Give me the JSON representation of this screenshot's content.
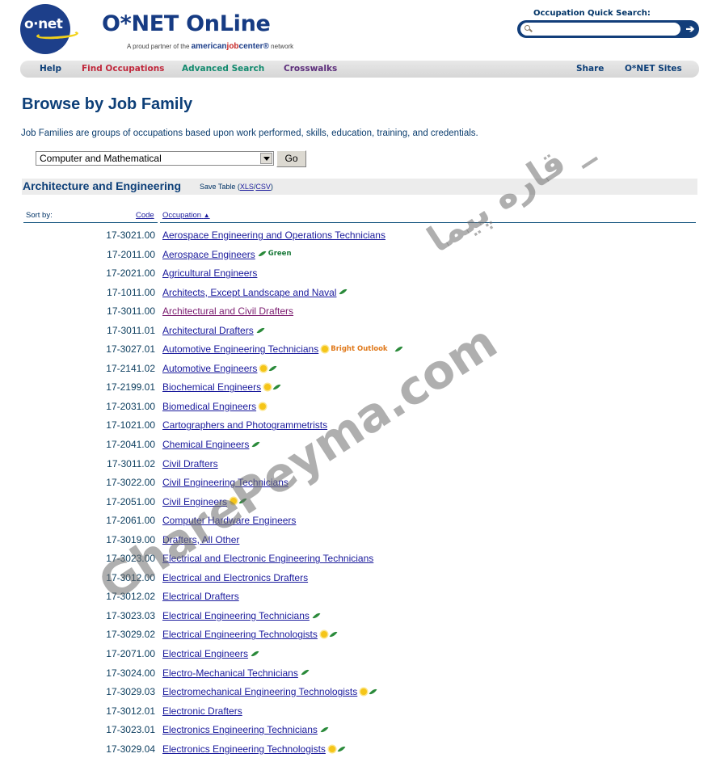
{
  "header": {
    "logo_text": "o·net",
    "site_title": "O*NET OnLine",
    "tagline_prefix": "A proud partner of the",
    "tagline_brand_a": "american",
    "tagline_brand_b": "job",
    "tagline_brand_c": "center®",
    "tagline_suffix": "network",
    "quick_search": {
      "label": "Occupation Quick Search:",
      "value": "",
      "placeholder": "",
      "go_icon": "arrow-right-icon"
    }
  },
  "nav": {
    "left": [
      {
        "label": "Help",
        "color": "#0d3f78"
      },
      {
        "label": "Find Occupations",
        "color": "#c0283c"
      },
      {
        "label": "Advanced Search",
        "color": "#128a6e"
      },
      {
        "label": "Crosswalks",
        "color": "#5b2c7a"
      }
    ],
    "right": [
      {
        "label": "Share",
        "color": "#0d3f78"
      },
      {
        "label": "O*NET Sites",
        "color": "#0d3f78"
      }
    ]
  },
  "main": {
    "title": "Browse by Job Family",
    "intro": "Job Families are groups of occupations based upon work performed, skills, education, training, and credentials.",
    "family_select": {
      "selected": "Computer and Mathematical"
    },
    "go_label": "Go",
    "section": {
      "title": "Architecture and Engineering",
      "save_table_prefix": "Save Table (",
      "xls": "XLS",
      "sep": "/",
      "csv": "CSV",
      "save_table_suffix": ")"
    },
    "sort": {
      "label": "Sort by:",
      "code": "Code",
      "occupation": "Occupation",
      "direction_icon": "▲"
    },
    "badge_labels": {
      "green": "Green",
      "bright": "Bright Outlook"
    },
    "occupations": [
      {
        "code": "17-3021.00",
        "name": "Aerospace Engineering and Operations Technicians",
        "bright": false,
        "green": false
      },
      {
        "code": "17-2011.00",
        "name": "Aerospace Engineers",
        "bright": false,
        "green": true,
        "green_label": true
      },
      {
        "code": "17-2021.00",
        "name": "Agricultural Engineers",
        "bright": false,
        "green": false
      },
      {
        "code": "17-1011.00",
        "name": "Architects, Except Landscape and Naval",
        "bright": false,
        "green": true
      },
      {
        "code": "17-3011.00",
        "name": "Architectural and Civil Drafters",
        "bright": false,
        "green": false,
        "visited": true
      },
      {
        "code": "17-3011.01",
        "name": "Architectural Drafters",
        "bright": false,
        "green": true
      },
      {
        "code": "17-3027.01",
        "name": "Automotive Engineering Technicians",
        "bright": true,
        "green": true,
        "bright_label": true
      },
      {
        "code": "17-2141.02",
        "name": "Automotive Engineers",
        "bright": true,
        "green": true
      },
      {
        "code": "17-2199.01",
        "name": "Biochemical Engineers",
        "bright": true,
        "green": true
      },
      {
        "code": "17-2031.00",
        "name": "Biomedical Engineers",
        "bright": true,
        "green": false
      },
      {
        "code": "17-1021.00",
        "name": "Cartographers and Photogrammetrists",
        "bright": false,
        "green": false
      },
      {
        "code": "17-2041.00",
        "name": "Chemical Engineers",
        "bright": false,
        "green": true
      },
      {
        "code": "17-3011.02",
        "name": "Civil Drafters",
        "bright": false,
        "green": false
      },
      {
        "code": "17-3022.00",
        "name": "Civil Engineering Technicians",
        "bright": false,
        "green": false
      },
      {
        "code": "17-2051.00",
        "name": "Civil Engineers",
        "bright": true,
        "green": true
      },
      {
        "code": "17-2061.00",
        "name": "Computer Hardware Engineers",
        "bright": false,
        "green": false
      },
      {
        "code": "17-3019.00",
        "name": "Drafters, All Other",
        "bright": false,
        "green": false
      },
      {
        "code": "17-3023.00",
        "name": "Electrical and Electronic Engineering Technicians",
        "bright": false,
        "green": false
      },
      {
        "code": "17-3012.00",
        "name": "Electrical and Electronics Drafters",
        "bright": false,
        "green": false
      },
      {
        "code": "17-3012.02",
        "name": "Electrical Drafters",
        "bright": false,
        "green": false
      },
      {
        "code": "17-3023.03",
        "name": "Electrical Engineering Technicians",
        "bright": false,
        "green": true
      },
      {
        "code": "17-3029.02",
        "name": "Electrical Engineering Technologists",
        "bright": true,
        "green": true
      },
      {
        "code": "17-2071.00",
        "name": "Electrical Engineers",
        "bright": false,
        "green": true
      },
      {
        "code": "17-3024.00",
        "name": "Electro-Mechanical Technicians",
        "bright": false,
        "green": true
      },
      {
        "code": "17-3029.03",
        "name": "Electromechanical Engineering Technologists",
        "bright": true,
        "green": true
      },
      {
        "code": "17-3012.01",
        "name": "Electronic Drafters",
        "bright": false,
        "green": false
      },
      {
        "code": "17-3023.01",
        "name": "Electronics Engineering Technicians",
        "bright": false,
        "green": true
      },
      {
        "code": "17-3029.04",
        "name": "Electronics Engineering Technologists",
        "bright": true,
        "green": true
      }
    ]
  },
  "watermark": {
    "latin": "GharePeyma.com",
    "persian": "قاره پیما _"
  }
}
